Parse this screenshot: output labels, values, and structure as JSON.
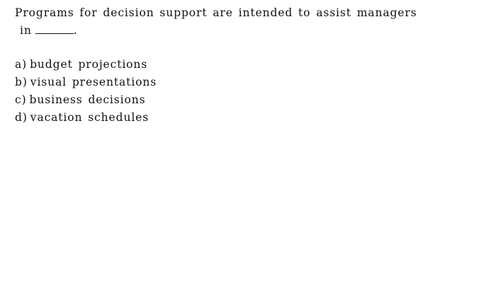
{
  "question": {
    "line1": "Programs for decision support are intended to assist managers",
    "line2_prefix": "in",
    "line2_suffix": "."
  },
  "options": [
    {
      "letter": "a)",
      "text": "budget projections"
    },
    {
      "letter": "b)",
      "text": "visual presentations"
    },
    {
      "letter": "c)",
      "text": "business decisions"
    },
    {
      "letter": "d)",
      "text": "vacation schedules"
    }
  ]
}
